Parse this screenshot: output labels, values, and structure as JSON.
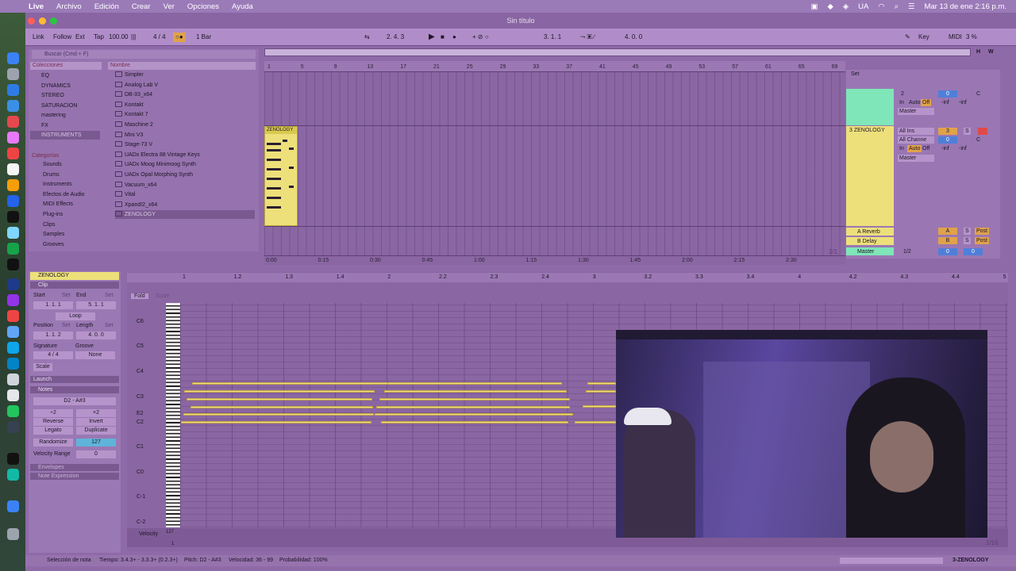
{
  "menubar": {
    "app": "Live",
    "items": [
      "Archivo",
      "Edición",
      "Crear",
      "Ver",
      "Opciones",
      "Ayuda"
    ],
    "locale": "UA",
    "datetime": "Mar 13 de ene  2:16 p.m."
  },
  "window": {
    "title": "Sin título"
  },
  "transport": {
    "link": "Link",
    "follow": "Follow",
    "ext": "Ext",
    "tap": "Tap",
    "tempo": "100.00",
    "signature": "4 / 4",
    "quant": "1 Bar",
    "position": "2.  4.  3",
    "loop_start": "3.  1.  1",
    "loop_len": "4.  0.  0",
    "key": "Key",
    "midi": "MIDI",
    "cpu": "3 %"
  },
  "browser": {
    "search": "Buscar (Cmd + F)",
    "collections_header": "Colecciones",
    "collections": [
      "EQ",
      "DYNAMICS",
      "STEREO",
      "SATURACION",
      "mastering",
      "FX",
      "INSTRUMENTS"
    ],
    "categories_header": "Categorías",
    "categories": [
      "Sounds",
      "Drums",
      "Instruments",
      "Efectos de Audio",
      "MIDI Effects",
      "Plug-ins",
      "Clips",
      "Samples",
      "Grooves"
    ],
    "name_header": "Nombre",
    "items": [
      "Simpler",
      "Analog Lab V",
      "DB-33_x64",
      "Kontakt",
      "Kontakt 7",
      "Maschine 2",
      "Mini V3",
      "Stage-73 V",
      "UADx Electra 88 Vintage Keys",
      "UADx Moog Minimoog Synth",
      "UADx Opal Morphing Synth",
      "Vacuum_x64",
      "Vital",
      "Xpand!2_x64",
      "ZENOLOGY"
    ]
  },
  "arrangement": {
    "bars": [
      "1",
      "5",
      "9",
      "13",
      "17",
      "21",
      "25",
      "29",
      "33",
      "37",
      "41",
      "45",
      "49",
      "53",
      "57",
      "61",
      "65",
      "69"
    ],
    "times": [
      "0:00",
      "0:15",
      "0:30",
      "0:45",
      "1:00",
      "1:15",
      "1:30",
      "1:45",
      "2:00",
      "2:15",
      "2:30"
    ],
    "clip_name": "ZENOLOGY",
    "loop_counter": "1/1"
  },
  "mixer": {
    "set": "Set",
    "track2": {
      "num": "2",
      "in": "In",
      "auto": "Auto",
      "off": "Off",
      "vol": "0",
      "pan": "C",
      "inf1": "-inf",
      "inf2": "-inf",
      "out": "Master"
    },
    "track3": {
      "name": "3 ZENOLOGY",
      "input": "All Ins",
      "channel": "All Channe",
      "in": "In",
      "auto": "Auto",
      "off": "Off",
      "num": "3",
      "s": "S",
      "vol": "0",
      "pan": "C",
      "inf1": "-inf",
      "inf2": "-inf",
      "out": "Master"
    },
    "returns": [
      {
        "name": "A Reverb",
        "letter": "A",
        "s": "S",
        "post": "Post"
      },
      {
        "name": "B Delay",
        "letter": "B",
        "s": "S",
        "post": "Post"
      }
    ],
    "master": {
      "name": "Master",
      "ratio": "1/2",
      "vol": "0",
      "vol2": "0"
    }
  },
  "clipview": {
    "title": "ZENOLOGY",
    "clip": "Clip",
    "start": "Start",
    "set": "Set",
    "end": "End",
    "start_val": "1.   1.   1",
    "end_val": "5.   1.   1",
    "loop": "Loop",
    "position": "Position",
    "length": "Length",
    "pos_val": "1.   1.   2",
    "len_val": "4.   0.   0",
    "signature": "Signature",
    "groove": "Groove",
    "sig_val": "4  /  4",
    "groove_val": "None",
    "scale": "Scale",
    "launch": "Launch",
    "notes": "Notes",
    "range": "D2 - A#3",
    "x2a": "÷2",
    "x2b": "×2",
    "reverse": "Reverse",
    "invert": "Invert",
    "legato": "Legato",
    "duplicate": "Duplicate",
    "randomize": "Randomize",
    "rand_val": "127",
    "vel_range": "Velocity Range",
    "vel_val": "0",
    "envelopes": "Envelopes",
    "note_expr": "Note Expression"
  },
  "pianoroll": {
    "fold": "Fold",
    "scale": "Scale",
    "beats": [
      "1",
      "1.2",
      "1.3",
      "1.4",
      "2",
      "2.2",
      "2.3",
      "2.4",
      "3",
      "3.2",
      "3.3",
      "3.4",
      "4",
      "4.2",
      "4.3",
      "4.4",
      "5"
    ],
    "octaves": [
      "C6",
      "C5",
      "C4",
      "C3",
      "E2",
      "C2",
      "C1",
      "C0",
      "C-1",
      "C-2"
    ],
    "velocity": "Velocity",
    "vel_max": "127",
    "vel_min": "1",
    "zoom": "1/16"
  },
  "status": {
    "mode": "Selección de nota",
    "time": "Tiempo: 3.4.3+ - 3.3.3+ (0.2.3+)",
    "pitch": "Pitch: D2 - A#3",
    "velocity": "Velocidad: 36 - 99",
    "prob": "Probabilidad: 100%",
    "track": "3-ZENOLOGY"
  },
  "colors": {
    "accent": "#f0e07a",
    "track_green": "#7ee6b8",
    "bg": "#8f6aa8"
  }
}
